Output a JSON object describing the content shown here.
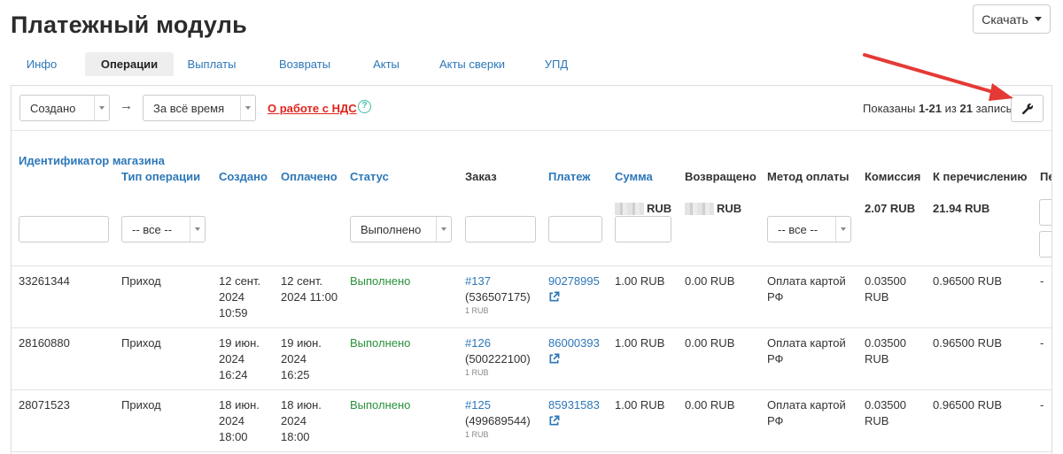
{
  "page": {
    "title": "Платежный модуль"
  },
  "download": {
    "label": "Скачать"
  },
  "tabs": [
    {
      "label": "Инфо",
      "active": false
    },
    {
      "label": "Операции",
      "active": true
    },
    {
      "label": "Выплаты",
      "active": false
    },
    {
      "label": "Возвраты",
      "active": false
    },
    {
      "label": "Акты",
      "active": false
    },
    {
      "label": "Акты сверки",
      "active": false
    },
    {
      "label": "УПД",
      "active": false
    }
  ],
  "toolbar": {
    "date_field": "Создано",
    "arrow": "→",
    "period": "За всё время",
    "vat_link": "О работе с НДС",
    "help": "?",
    "shown_prefix": "Показаны",
    "shown_range": "1-21",
    "shown_of": "из",
    "shown_total": "21",
    "shown_suffix": "запись."
  },
  "columns": {
    "shop_id": "Идентификатор магазина",
    "op_type": "Тип операции",
    "created": "Создано",
    "paid": "Оплачено",
    "status": "Статус",
    "order": "Заказ",
    "payment": "Платеж",
    "amount": "Сумма",
    "refunded": "Возвращено",
    "method": "Метод оплаты",
    "commission": "Комиссия",
    "to_transfer": "К перечислению",
    "next": "Пе"
  },
  "filters": {
    "op_type": "-- все --",
    "status": "Выполнено",
    "method": "-- все --"
  },
  "totals": {
    "amount_currency": "RUB",
    "refunded_currency": "RUB",
    "commission": "2.07 RUB",
    "to_transfer": "21.94 RUB"
  },
  "rows": [
    {
      "shop_id": "33261344",
      "op_type": "Приход",
      "created_date": "12 сент.",
      "created_year": "2024",
      "created_time": "10:59",
      "paid_date": "12 сент.",
      "paid_rest": "2024 11:00",
      "status": "Выполнено",
      "order_num": "#137",
      "order_ref": "(536507175)",
      "order_sum": "1 RUB",
      "payment": "90278995",
      "amount": "1.00 RUB",
      "refunded": "0.00 RUB",
      "method_l1": "Оплата картой",
      "method_l2": "РФ",
      "commission_l1": "0.03500",
      "commission_l2": "RUB",
      "to_transfer": "0.96500 RUB",
      "next": "-"
    },
    {
      "shop_id": "28160880",
      "op_type": "Приход",
      "created_date": "19 июн.",
      "created_year": "2024",
      "created_time": "16:24",
      "paid_date": "19 июн.",
      "paid_year": "2024",
      "paid_time": "16:25",
      "status": "Выполнено",
      "order_num": "#126",
      "order_ref": "(500222100)",
      "order_sum": "1 RUB",
      "payment": "86000393",
      "amount": "1.00 RUB",
      "refunded": "0.00 RUB",
      "method_l1": "Оплата картой",
      "method_l2": "РФ",
      "commission_l1": "0.03500",
      "commission_l2": "RUB",
      "to_transfer": "0.96500 RUB",
      "next": "-"
    },
    {
      "shop_id": "28071523",
      "op_type": "Приход",
      "created_date": "18 июн.",
      "created_year": "2024",
      "created_time": "18:00",
      "paid_date": "18 июн.",
      "paid_year": "2024",
      "paid_time": "18:00",
      "status": "Выполнено",
      "order_num": "#125",
      "order_ref": "(499689544)",
      "order_sum": "1 RUB",
      "payment": "85931583",
      "amount": "1.00 RUB",
      "refunded": "0.00 RUB",
      "method_l1": "Оплата картой",
      "method_l2": "РФ",
      "commission_l1": "0.03500",
      "commission_l2": "RUB",
      "to_transfer": "0.96500 RUB",
      "next": "-"
    }
  ],
  "colors": {
    "link": "#2d77b8",
    "success": "#28923a",
    "alert": "#e0241c",
    "help": "#3fbfa4",
    "annotation": "#e53935"
  },
  "icons": {
    "settings": "wrench-icon",
    "external": "external-link-icon",
    "help": "help-circle-icon"
  }
}
